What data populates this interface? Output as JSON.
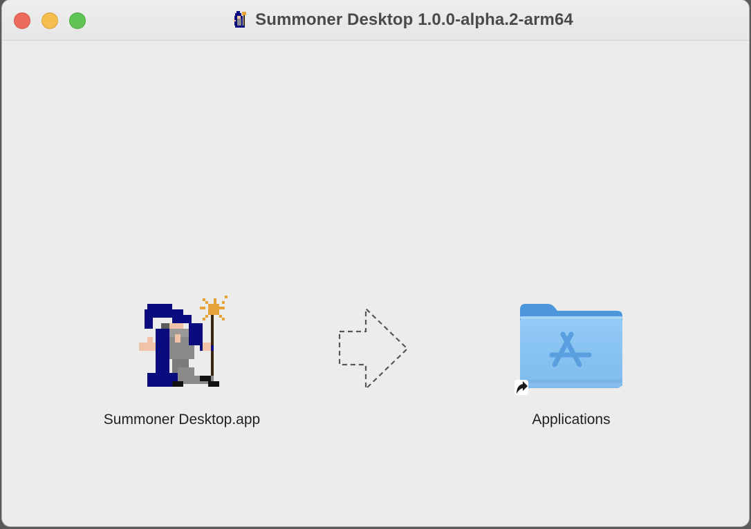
{
  "window": {
    "title": "Summoner Desktop 1.0.0-alpha.2-arm64",
    "title_icon": "wizard-icon",
    "buttons": {
      "close": "close-button",
      "minimize": "minimize-button",
      "maximize": "maximize-button"
    }
  },
  "content": {
    "app": {
      "label": "Summoner Desktop.app",
      "icon": "wizard-app-icon"
    },
    "drag_arrow": {
      "icon": "dashed-arrow-icon"
    },
    "applications": {
      "label": "Applications",
      "icon": "applications-folder-icon",
      "alias_badge": "alias-arrow-icon"
    }
  },
  "colors": {
    "window_bg": "#ececec",
    "title_text": "#4a4a4a",
    "close": "#ed6a5e",
    "minimize": "#f5bf4f",
    "maximize": "#61c554",
    "folder": "#86c2f3"
  }
}
